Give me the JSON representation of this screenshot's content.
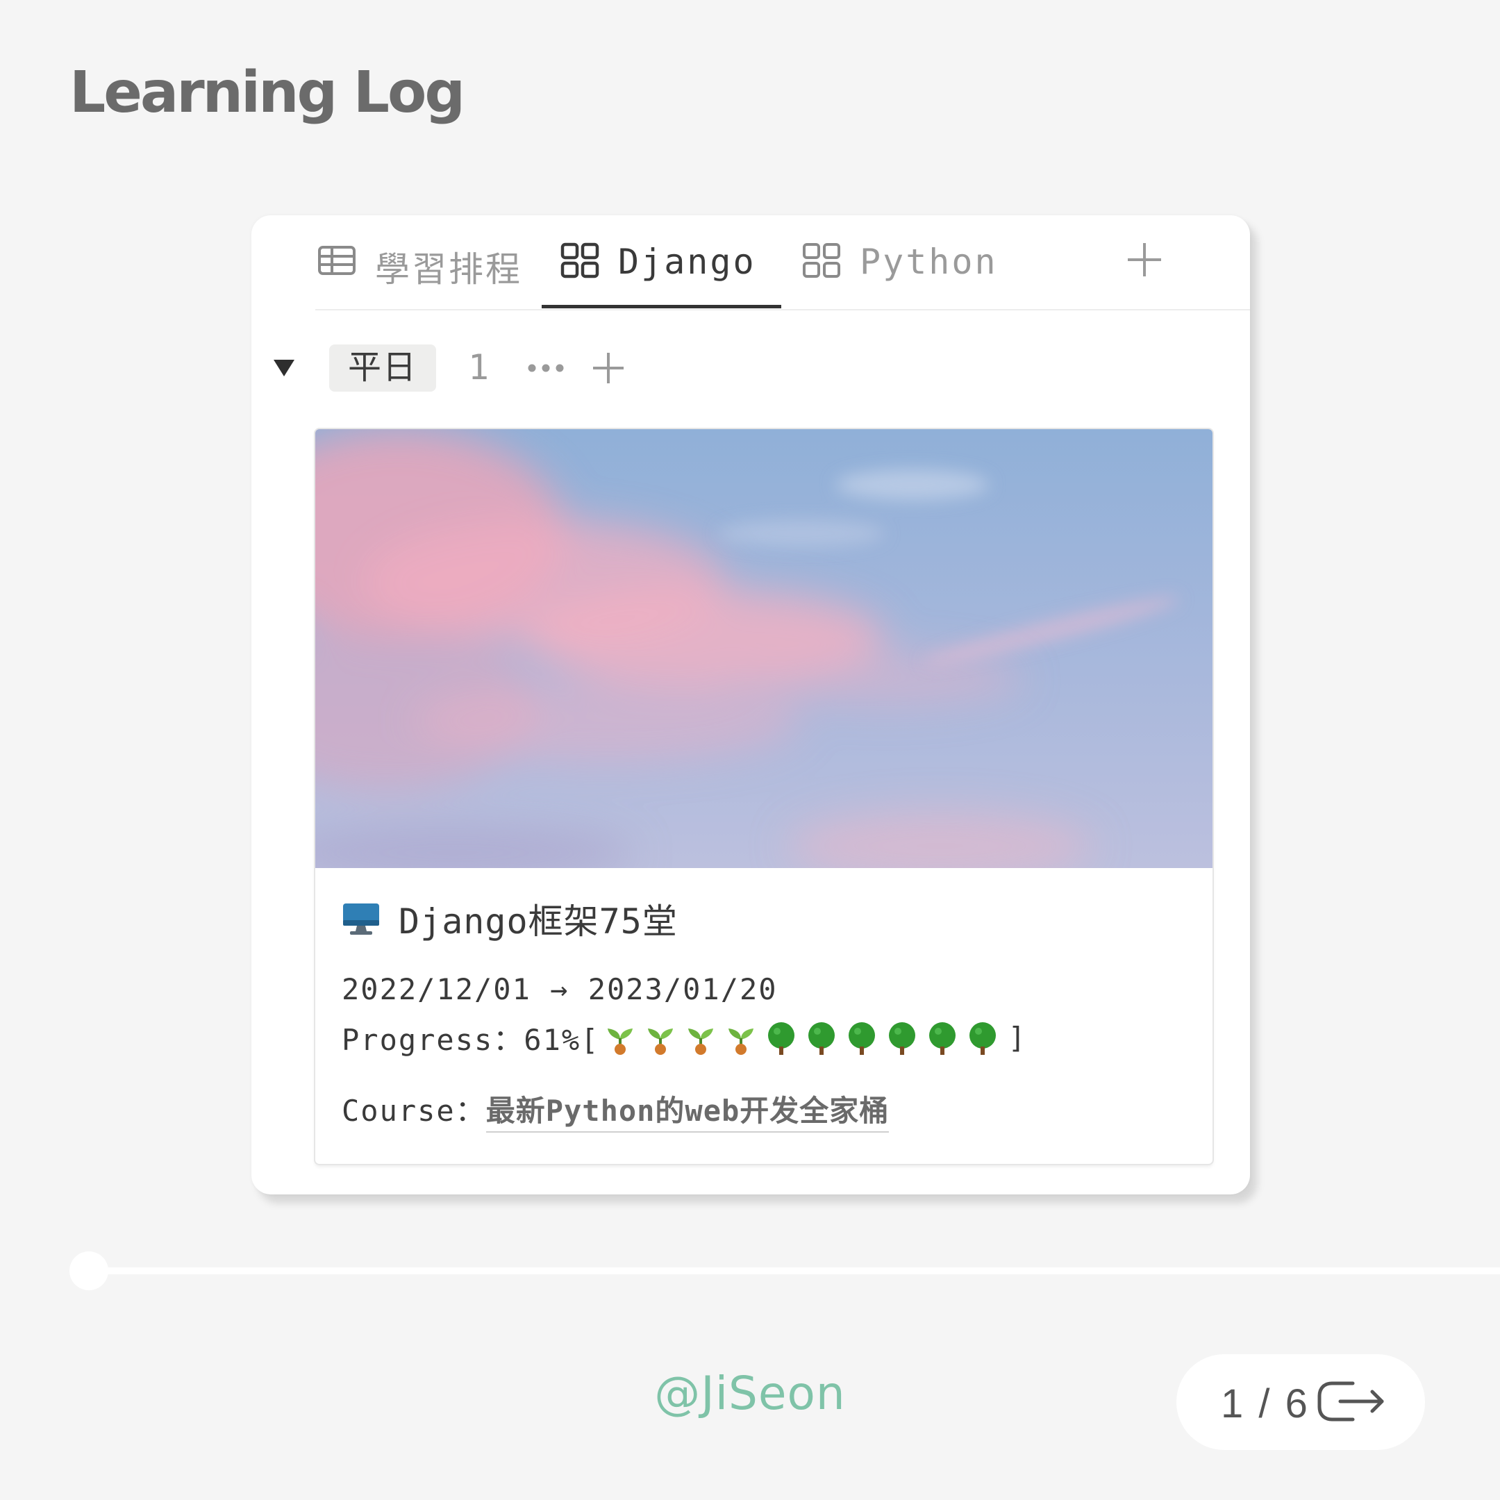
{
  "page": {
    "title": "Learning Log"
  },
  "tabs": [
    {
      "label": "學習排程",
      "icon": "table-icon"
    },
    {
      "label": "Django",
      "icon": "gallery-icon",
      "active": true
    },
    {
      "label": "Python",
      "icon": "gallery-icon"
    }
  ],
  "group": {
    "label": "平日",
    "count": "1"
  },
  "card": {
    "icon": "desktop-computer-icon",
    "title": "Django框架75堂",
    "date_range": "2022/12/01 → 2023/01/20",
    "progress_label": "Progress：61%[",
    "progress_close": "]",
    "progress_value": 0.61,
    "progress_sprouts": 4,
    "progress_trees": 6,
    "course_label": "Course：",
    "course_link": "最新Python的web开发全家桶"
  },
  "slider": {
    "value": 0
  },
  "footer": {
    "handle": "@JiSeon",
    "pager": "1 / 6"
  },
  "colors": {
    "handle": "#7fc3a8",
    "title": "#6b6b6b",
    "active_tab_underline": "#333333"
  }
}
